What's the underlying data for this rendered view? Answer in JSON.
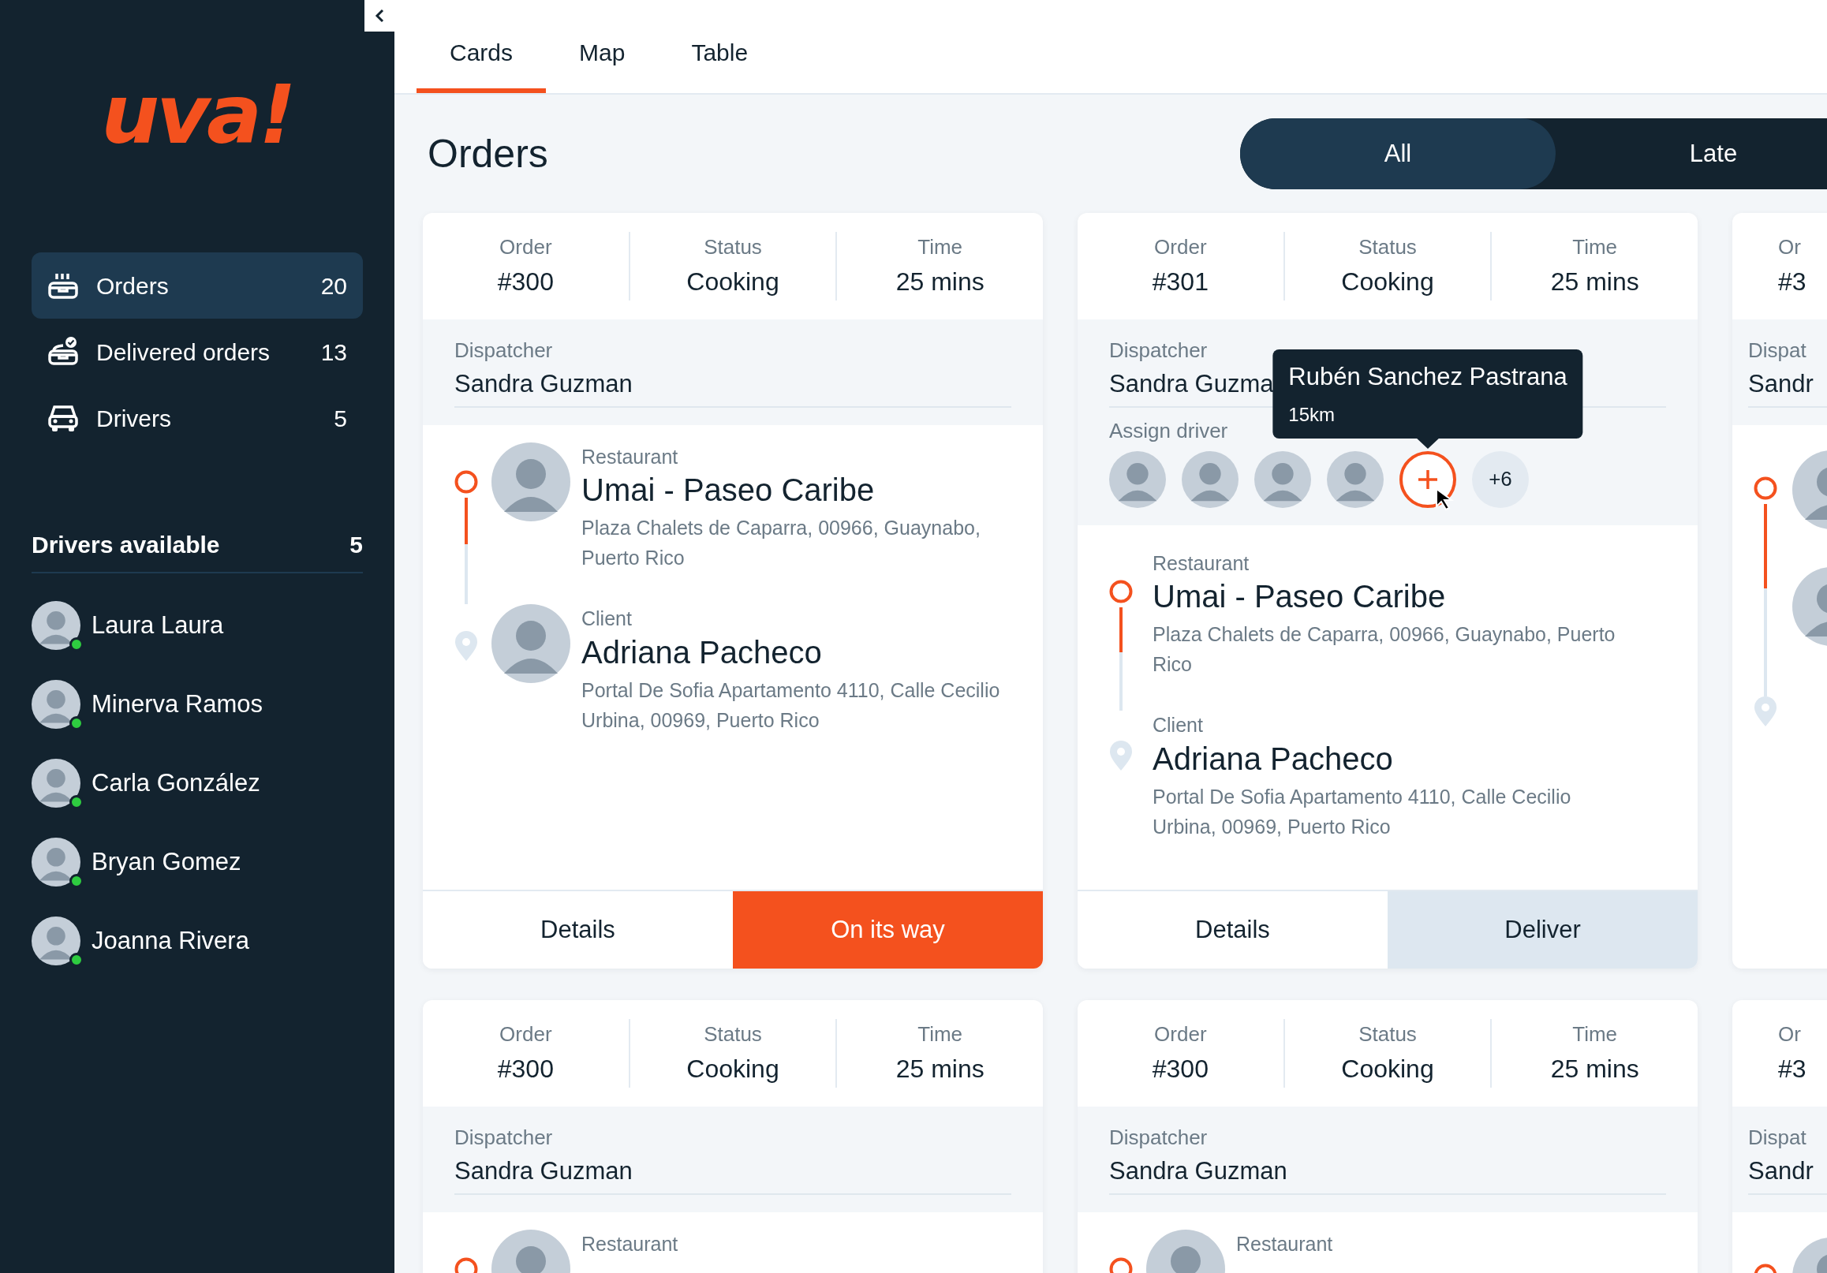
{
  "sidebar": {
    "logo": "uva!",
    "nav": [
      {
        "label": "Orders",
        "count": "20",
        "selected": true
      },
      {
        "label": "Delivered orders",
        "count": "13",
        "selected": false
      },
      {
        "label": "Drivers",
        "count": "5",
        "selected": false
      }
    ],
    "drivers_title": "Drivers available",
    "drivers_count": "5",
    "drivers": [
      {
        "name": "Laura Laura",
        "online": true
      },
      {
        "name": "Minerva Ramos",
        "online": true
      },
      {
        "name": "Carla González",
        "online": true
      },
      {
        "name": "Bryan Gomez",
        "online": true
      },
      {
        "name": "Joanna Rivera",
        "online": true
      }
    ]
  },
  "tabs": [
    {
      "label": "Cards",
      "selected": true
    },
    {
      "label": "Map",
      "selected": false
    },
    {
      "label": "Table",
      "selected": false
    }
  ],
  "title": "Orders",
  "filters": [
    {
      "label": "All",
      "selected": true
    },
    {
      "label": "Late",
      "selected": false
    }
  ],
  "cards": [
    {
      "kind": "full",
      "fields": [
        {
          "label": "Order",
          "value": "#300"
        },
        {
          "label": "Status",
          "value": "Cooking"
        },
        {
          "label": "Time",
          "value": "25 mins"
        }
      ],
      "dispatcher": {
        "label": "Dispatcher",
        "value": "Sandra Guzman"
      },
      "avatars": true,
      "stops": [
        {
          "label": "Restaurant",
          "name": "Umai - Paseo Caribe",
          "address": "Plaza Chalets de Caparra, 00966, Guaynabo, Puerto Rico"
        },
        {
          "label": "Client",
          "name": "Adriana Pacheco",
          "address": "Portal De Sofia Apartamento 4110, Calle Cecilio Urbina, 00969, Puerto Rico"
        }
      ],
      "actions": [
        {
          "label": "Details",
          "kind": "plain"
        },
        {
          "label": "On its way",
          "kind": "primary"
        }
      ]
    },
    {
      "kind": "full",
      "fields": [
        {
          "label": "Order",
          "value": "#301"
        },
        {
          "label": "Status",
          "value": "Cooking"
        },
        {
          "label": "Time",
          "value": "25 mins"
        }
      ],
      "dispatcher": {
        "label": "Dispatcher",
        "value": "Sandra Guzma"
      },
      "avatars": false,
      "assign": {
        "label": "Assign driver",
        "more": "+6",
        "tooltip": {
          "name": "Rubén Sanchez Pastrana",
          "distance": "15km"
        }
      },
      "stops": [
        {
          "label": "Restaurant",
          "name": "Umai - Paseo Caribe",
          "address": "Plaza Chalets de Caparra, 00966, Guaynabo, Puerto Rico"
        },
        {
          "label": "Client",
          "name": "Adriana Pacheco",
          "address": "Portal De Sofia Apartamento 4110, Calle Cecilio Urbina, 00969, Puerto Rico"
        }
      ],
      "actions": [
        {
          "label": "Details",
          "kind": "plain"
        },
        {
          "label": "Deliver",
          "kind": "secondary"
        }
      ]
    },
    {
      "kind": "partial",
      "fields": [
        {
          "label": "Or",
          "value": "#3"
        }
      ],
      "dispatcher": {
        "label": "Dispat",
        "value": "Sandr"
      }
    },
    {
      "kind": "cut",
      "fields": [
        {
          "label": "Order",
          "value": "#300"
        },
        {
          "label": "Status",
          "value": "Cooking"
        },
        {
          "label": "Time",
          "value": "25 mins"
        }
      ],
      "dispatcher": {
        "label": "Dispatcher",
        "value": "Sandra Guzman"
      },
      "avatars": true,
      "stops": [
        {
          "label": "Restaurant"
        }
      ]
    },
    {
      "kind": "cut",
      "fields": [
        {
          "label": "Order",
          "value": "#300"
        },
        {
          "label": "Status",
          "value": "Cooking"
        },
        {
          "label": "Time",
          "value": "25 mins"
        }
      ],
      "dispatcher": {
        "label": "Dispatcher",
        "value": "Sandra Guzman"
      },
      "avatars": true,
      "stops": [
        {
          "label": "Restaurant"
        }
      ]
    },
    {
      "kind": "partial",
      "fields": [
        {
          "label": "Or",
          "value": "#3"
        }
      ],
      "dispatcher": {
        "label": "Dispat",
        "value": "Sandr"
      }
    }
  ]
}
